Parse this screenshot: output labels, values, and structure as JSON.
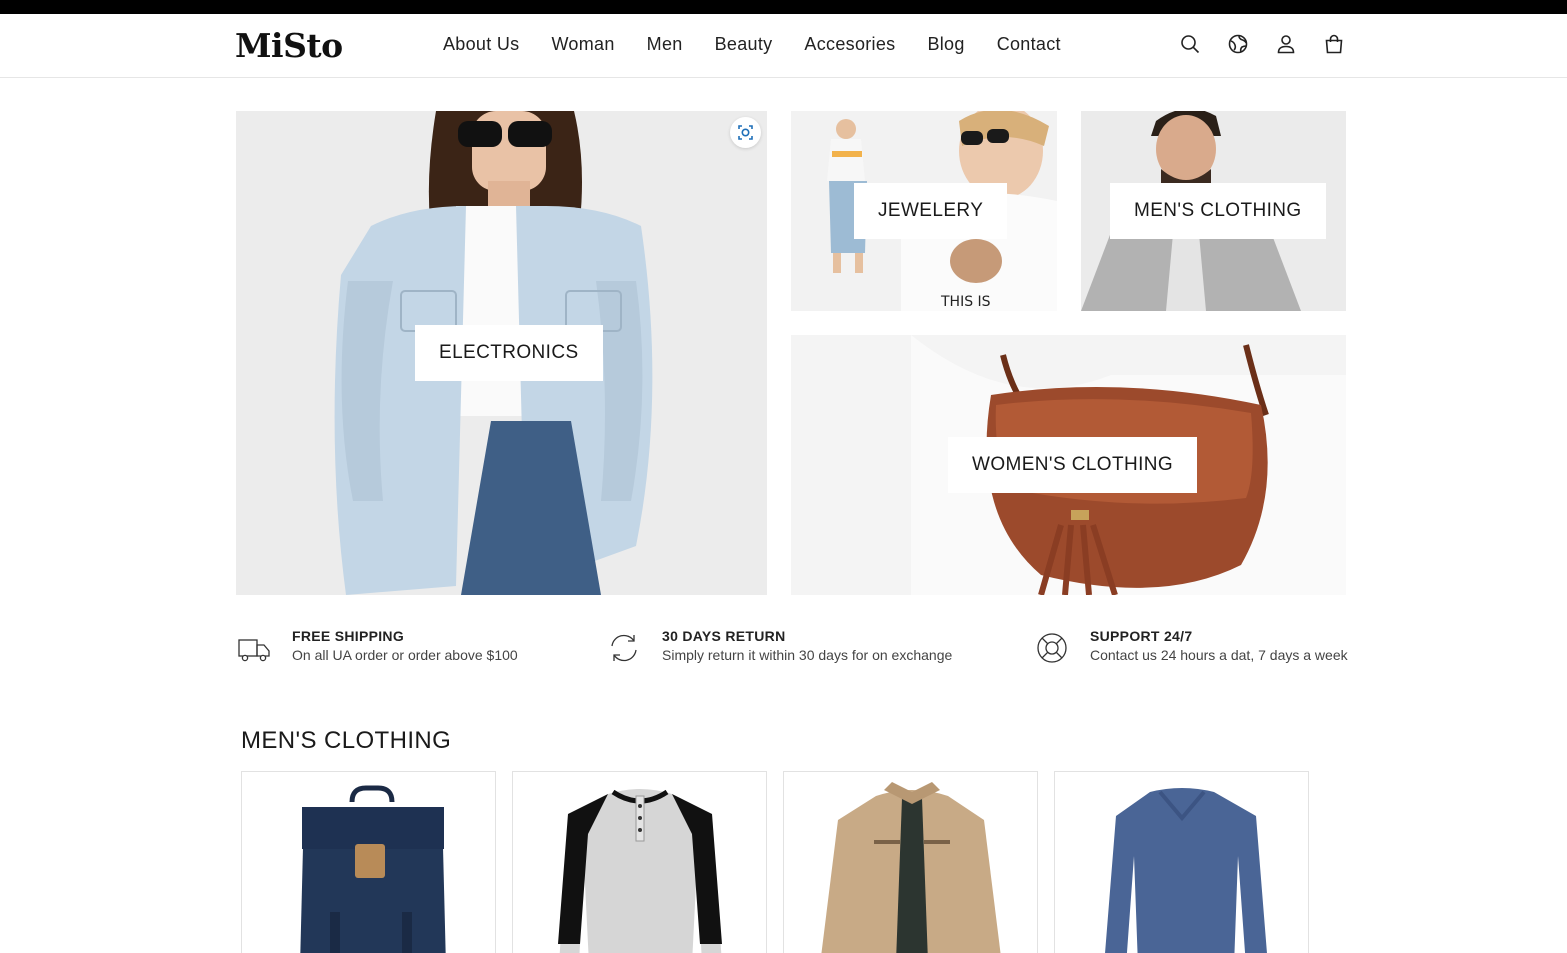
{
  "brand": {
    "logo": "MiSto"
  },
  "nav": {
    "items": [
      {
        "id": "about",
        "label": "About Us"
      },
      {
        "id": "woman",
        "label": "Woman"
      },
      {
        "id": "men",
        "label": "Men"
      },
      {
        "id": "beauty",
        "label": "Beauty"
      },
      {
        "id": "accesories",
        "label": "Accesories"
      },
      {
        "id": "blog",
        "label": "Blog"
      },
      {
        "id": "contact",
        "label": "Contact"
      }
    ]
  },
  "header_icons": [
    "search-icon",
    "globe-icon",
    "user-icon",
    "shopping-bag-icon"
  ],
  "categories": {
    "electronics": "ELECTRONICS",
    "jewelery": "JEWELERY",
    "mens": "MEN'S CLOTHING",
    "womens": "WOMEN'S CLOTHING"
  },
  "features": [
    {
      "icon": "truck-icon",
      "title": "FREE SHIPPING",
      "desc": "On all UA order or order above $100"
    },
    {
      "icon": "refresh-icon",
      "title": "30 DAYS RETURN",
      "desc": "Simply return it within 30 days for on exchange"
    },
    {
      "icon": "lifebuoy-icon",
      "title": "SUPPORT 24/7",
      "desc": "Contact us 24 hours a dat, 7 days a week"
    }
  ],
  "section": {
    "title": "MEN'S CLOTHING"
  },
  "products": [
    {
      "image": "navy-backpack"
    },
    {
      "image": "raglan-henley-shirt"
    },
    {
      "image": "beige-jacket"
    },
    {
      "image": "blue-vneck-longsleeve"
    }
  ],
  "colors": {
    "topbar": "#000000",
    "text": "#1a1a1a",
    "border": "#e2e2e2"
  }
}
